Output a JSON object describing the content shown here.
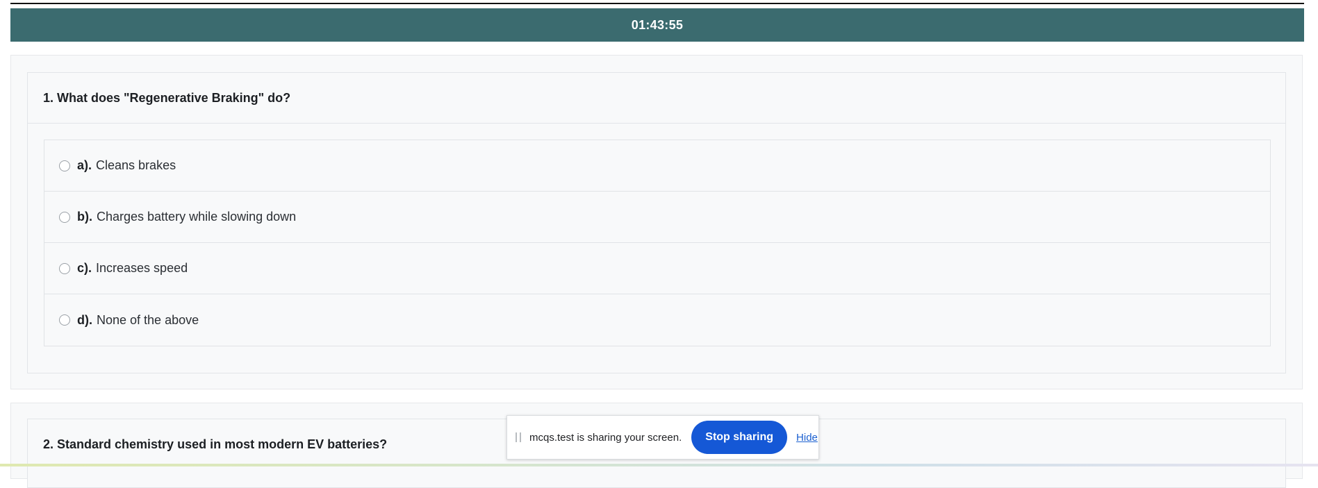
{
  "timer": {
    "value": "01:43:55"
  },
  "questions": [
    {
      "title": "1. What does \"Regenerative Braking\" do?",
      "options": [
        {
          "letter": "a).",
          "text": "Cleans brakes"
        },
        {
          "letter": "b).",
          "text": "Charges battery while slowing down"
        },
        {
          "letter": "c).",
          "text": "Increases speed"
        },
        {
          "letter": "d).",
          "text": "None of the above"
        }
      ]
    },
    {
      "title": "2. Standard chemistry used in most modern EV batteries?"
    }
  ],
  "screen_share": {
    "message": "mcqs.test is sharing your screen.",
    "stop_label": "Stop sharing",
    "hide_label": "Hide"
  },
  "colors": {
    "timer_bar": "#3b6b6f",
    "stop_button": "#1558d6"
  }
}
